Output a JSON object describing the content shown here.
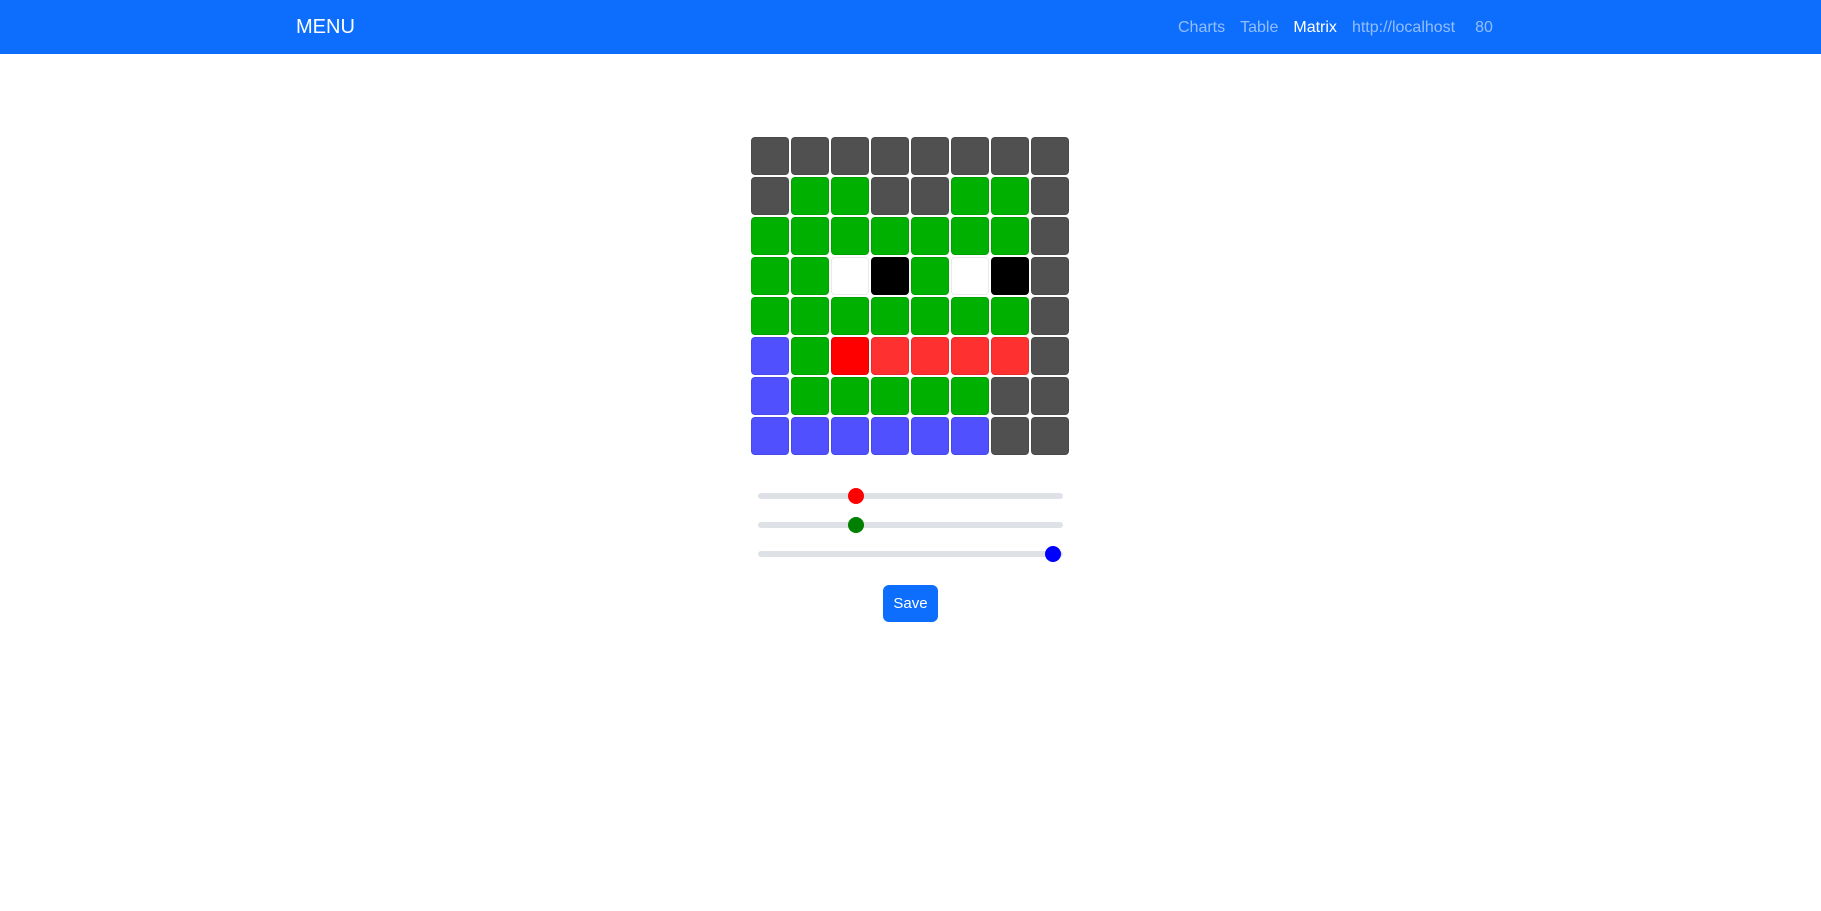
{
  "navbar": {
    "brand": "MENU",
    "links": [
      {
        "label": "Charts",
        "active": false
      },
      {
        "label": "Table",
        "active": false
      },
      {
        "label": "Matrix",
        "active": true
      }
    ],
    "host": "http://localhost",
    "port": "80",
    "color": "#0d6efd"
  },
  "matrix": {
    "rows": 8,
    "cols": 8,
    "cells": [
      [
        "#505050",
        "#505050",
        "#505050",
        "#505050",
        "#505050",
        "#505050",
        "#505050",
        "#505050"
      ],
      [
        "#505050",
        "#00b000",
        "#00b000",
        "#505050",
        "#505050",
        "#00b000",
        "#00b000",
        "#505050"
      ],
      [
        "#00b000",
        "#00b000",
        "#00b000",
        "#00b000",
        "#00b000",
        "#00b000",
        "#00b000",
        "#505050"
      ],
      [
        "#00b000",
        "#00b000",
        "#ffffff",
        "#000000",
        "#00b000",
        "#ffffff",
        "#000000",
        "#505050"
      ],
      [
        "#00b000",
        "#00b000",
        "#00b000",
        "#00b000",
        "#00b000",
        "#00b000",
        "#00b000",
        "#505050"
      ],
      [
        "#5050ff",
        "#00b000",
        "#ff0000",
        "#ff3030",
        "#ff3030",
        "#ff3030",
        "#ff3030",
        "#505050"
      ],
      [
        "#5050ff",
        "#00b000",
        "#00b000",
        "#00b000",
        "#00b000",
        "#00b000",
        "#505050",
        "#505050"
      ],
      [
        "#5050ff",
        "#5050ff",
        "#5050ff",
        "#5050ff",
        "#5050ff",
        "#5050ff",
        "#505050",
        "#505050"
      ]
    ]
  },
  "sliders": [
    {
      "channel": "red",
      "value_fraction": 0.31,
      "thumb_color": "#ff0000"
    },
    {
      "channel": "green",
      "value_fraction": 0.31,
      "thumb_color": "#008000"
    },
    {
      "channel": "blue",
      "value_fraction": 1.0,
      "thumb_color": "#0000ff"
    }
  ],
  "save_label": "Save"
}
